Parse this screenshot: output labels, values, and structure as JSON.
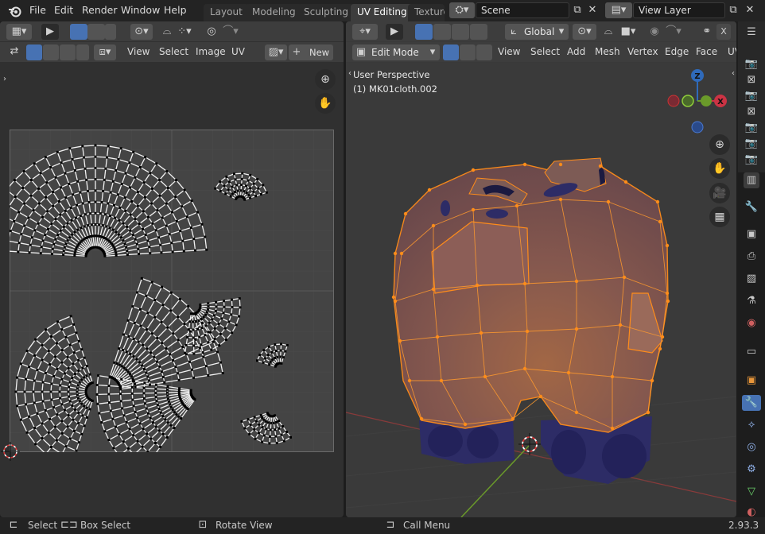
{
  "topbar": {
    "menus": [
      "File",
      "Edit",
      "Render",
      "Window",
      "Help"
    ],
    "workspaces": [
      {
        "label": "Layout",
        "active": false
      },
      {
        "label": "Modeling",
        "active": false
      },
      {
        "label": "Sculpting",
        "active": false
      },
      {
        "label": "UV Editing",
        "active": true
      },
      {
        "label": "Texture",
        "active": false
      }
    ],
    "scene": "Scene",
    "view_layer": "View Layer"
  },
  "uv_editor": {
    "menus": [
      "View",
      "Select",
      "Image",
      "UV"
    ],
    "new_label": "New"
  },
  "viewport": {
    "mode": "Edit Mode",
    "transform_orientation": "Global",
    "menus": [
      "View",
      "Select",
      "Add",
      "Mesh",
      "Vertex",
      "Edge",
      "Face",
      "UV"
    ],
    "overlay_title": "User Perspective",
    "overlay_object": "(1) MK01cloth.002",
    "gizmo": {
      "z": "Z",
      "x": "X"
    }
  },
  "statusbar": {
    "select": "Select",
    "box_select": "Box Select",
    "rotate_view": "Rotate View",
    "call_menu": "Call Menu",
    "version": "2.93.3"
  },
  "colors": {
    "accent": "#4772b3",
    "active_orange": "#ff8c1a",
    "mesh_body": "#8a5a4e",
    "mesh_dark": "#2d2c66"
  }
}
